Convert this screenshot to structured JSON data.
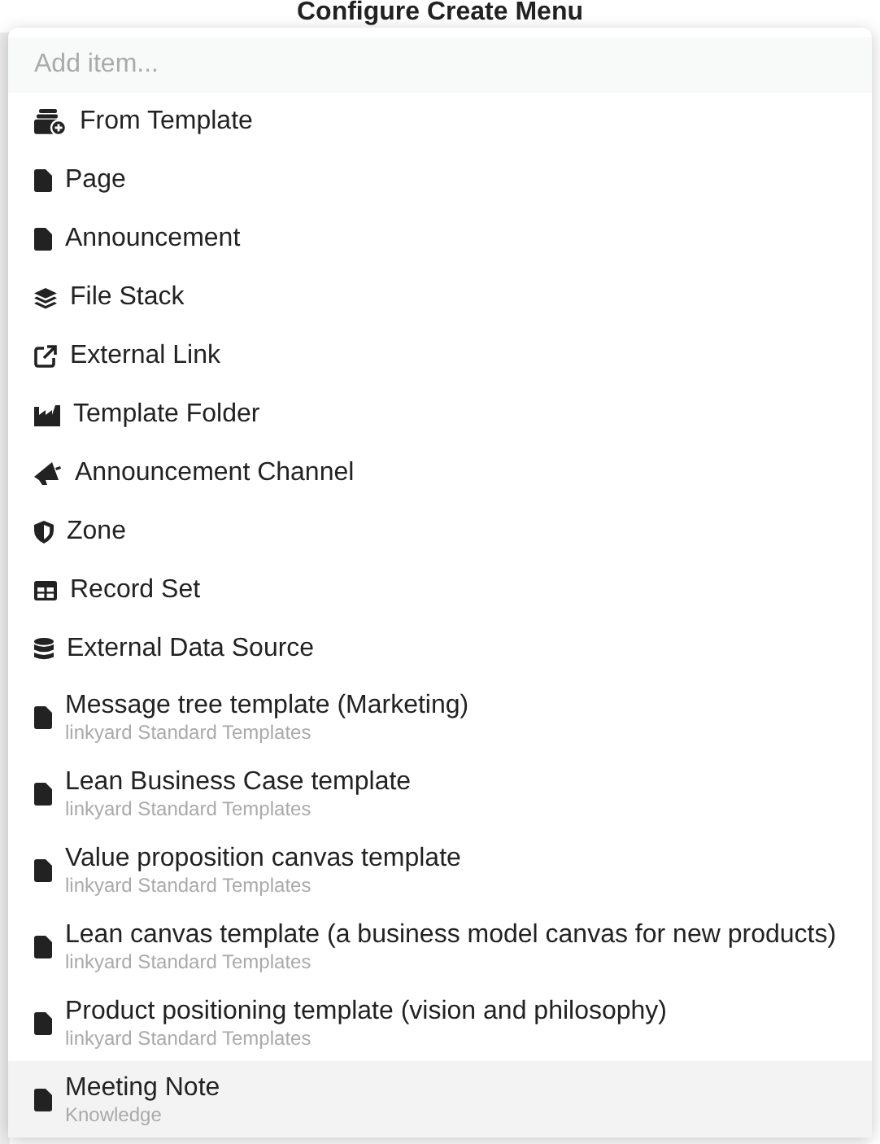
{
  "page": {
    "title": "Configure Create Menu"
  },
  "menu": {
    "search": {
      "placeholder": "Add item..."
    },
    "items": [
      {
        "label": "From Template",
        "selected": false
      },
      {
        "label": "Page",
        "selected": false
      },
      {
        "label": "Announcement",
        "selected": false
      },
      {
        "label": "File Stack",
        "selected": false
      },
      {
        "label": "External Link",
        "selected": false
      },
      {
        "label": "Template Folder",
        "selected": false
      },
      {
        "label": "Announcement Channel",
        "selected": false
      },
      {
        "label": "Zone",
        "selected": false
      },
      {
        "label": "Record Set",
        "selected": false
      },
      {
        "label": "External Data Source",
        "selected": false
      },
      {
        "label": "Message tree template (Marketing)",
        "subtitle": "linkyard Standard Templates",
        "selected": false
      },
      {
        "label": "Lean Business Case template",
        "subtitle": "linkyard Standard Templates",
        "selected": false
      },
      {
        "label": "Value proposition canvas template",
        "subtitle": "linkyard Standard Templates",
        "selected": false
      },
      {
        "label": "Lean canvas template (a business model canvas for new products)",
        "subtitle": "linkyard Standard Templates",
        "selected": false
      },
      {
        "label": "Product positioning template (vision and philosophy)",
        "subtitle": "linkyard Standard Templates",
        "selected": false
      },
      {
        "label": "Meeting Note",
        "subtitle": "Knowledge",
        "selected": true
      }
    ]
  }
}
